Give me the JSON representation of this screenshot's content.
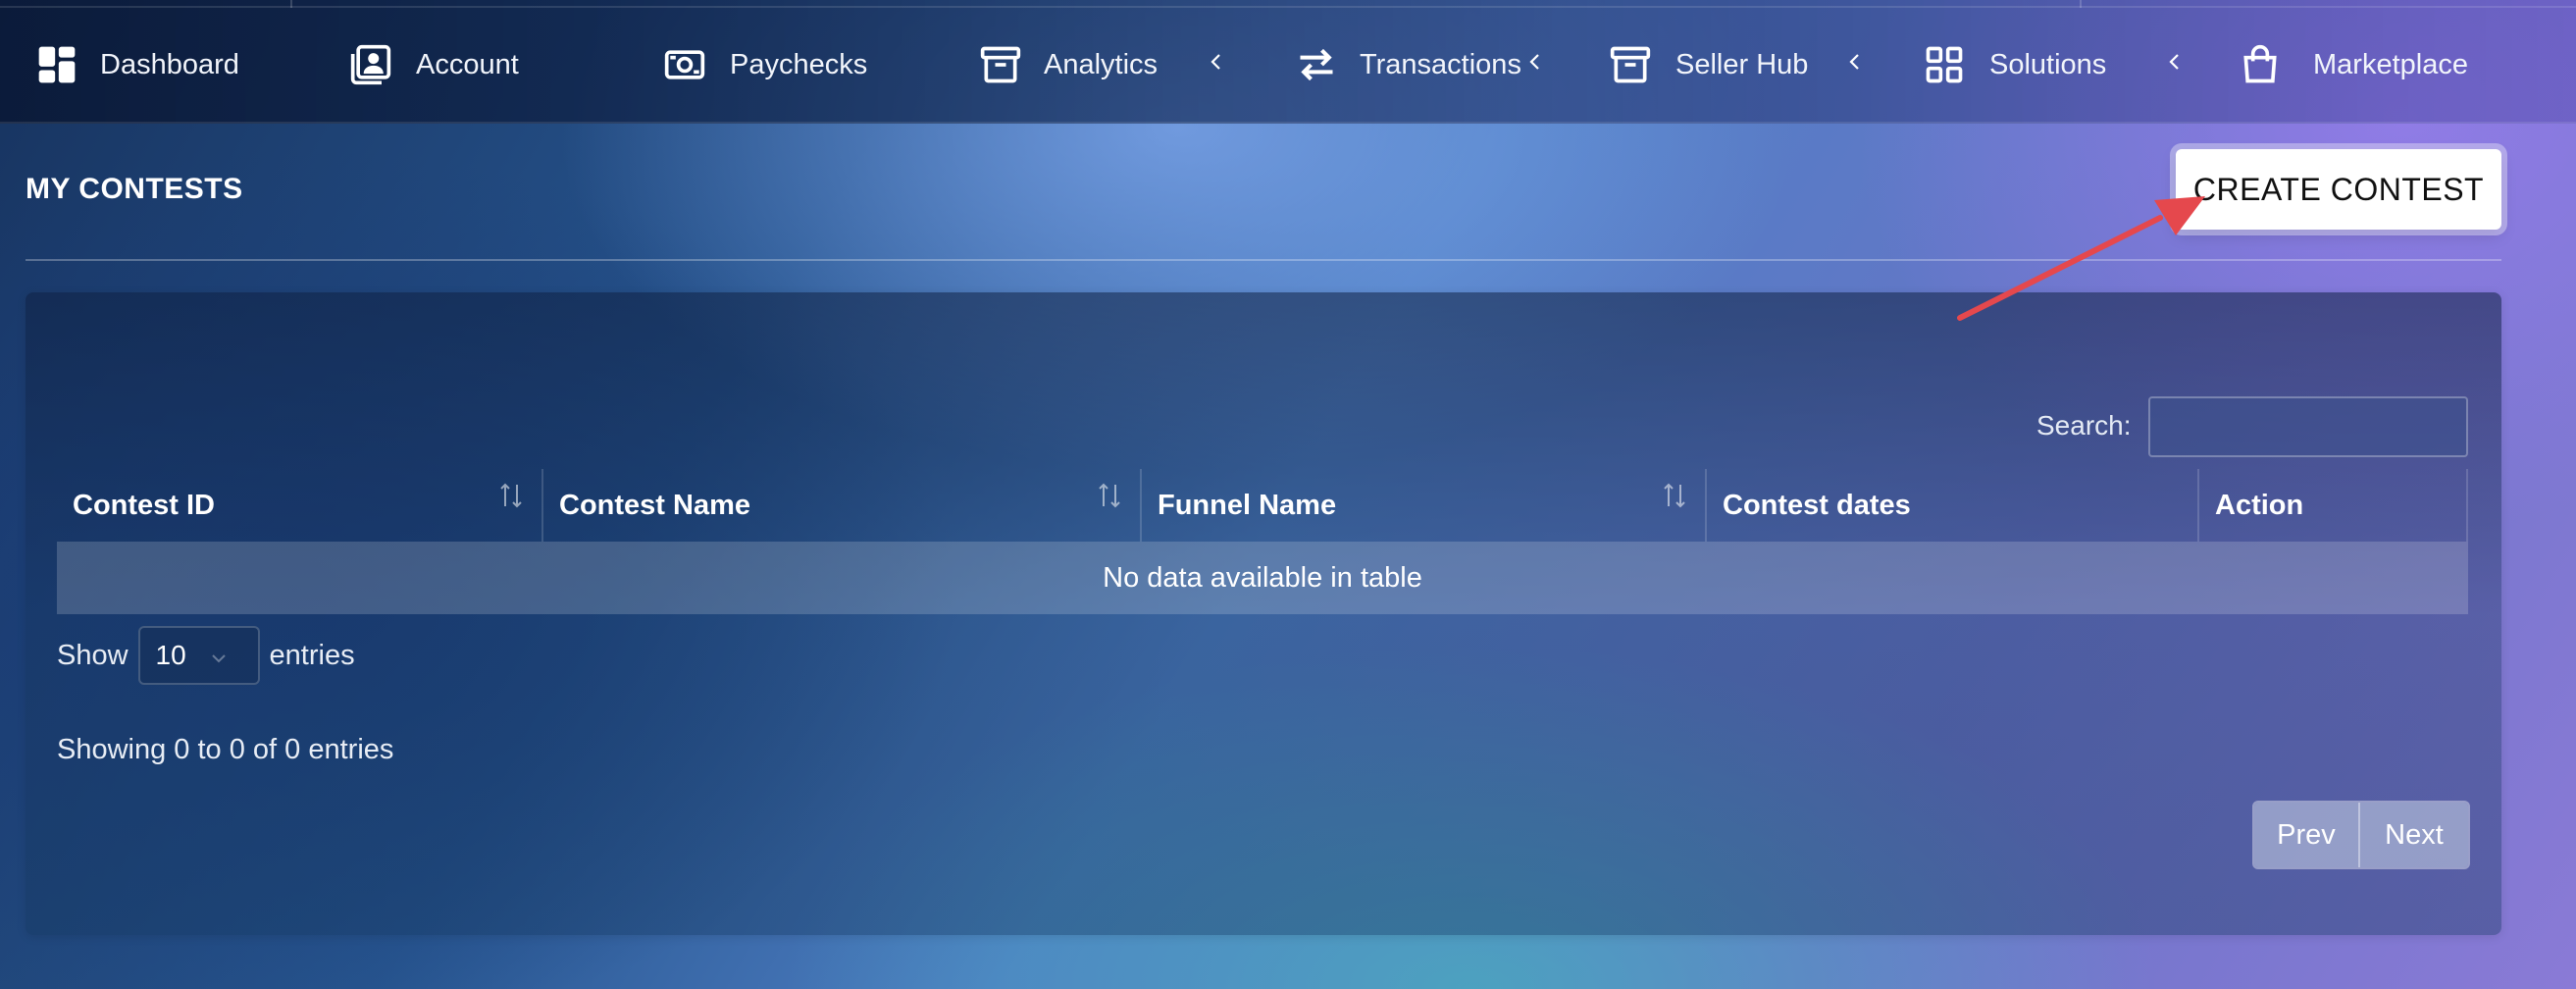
{
  "nav": {
    "items": [
      {
        "label": "Dashboard",
        "icon": "dashboard-icon",
        "has_chevron": false
      },
      {
        "label": "Account",
        "icon": "account-icon",
        "has_chevron": false
      },
      {
        "label": "Paychecks",
        "icon": "paychecks-icon",
        "has_chevron": false
      },
      {
        "label": "Analytics",
        "icon": "archive-icon",
        "has_chevron": true
      },
      {
        "label": "Transactions",
        "icon": "transfer-icon",
        "has_chevron": true
      },
      {
        "label": "Seller Hub",
        "icon": "store-icon",
        "has_chevron": true
      },
      {
        "label": "Solutions",
        "icon": "grid-icon",
        "has_chevron": true
      },
      {
        "label": "Marketplace",
        "icon": "shopping-bag-icon",
        "has_chevron": false
      }
    ]
  },
  "header": {
    "title": "MY CONTESTS",
    "create_button": "CREATE CONTEST"
  },
  "annotation": {
    "type": "arrow",
    "color": "#e5484d",
    "points_to": "create-contest-button"
  },
  "table": {
    "search_label": "Search:",
    "search_value": "",
    "columns": [
      {
        "label": "Contest ID",
        "sortable": true
      },
      {
        "label": "Contest Name",
        "sortable": true
      },
      {
        "label": "Funnel Name",
        "sortable": true
      },
      {
        "label": "Contest dates",
        "sortable": false
      },
      {
        "label": "Action",
        "sortable": false
      }
    ],
    "empty_message": "No data available in table",
    "show_prefix": "Show",
    "page_size": "10",
    "show_suffix": "entries",
    "info": "Showing 0 to 0 of 0 entries",
    "pager": {
      "prev": "Prev",
      "next": "Next"
    }
  }
}
